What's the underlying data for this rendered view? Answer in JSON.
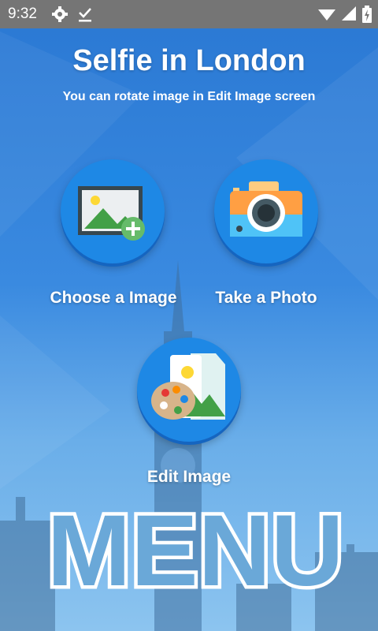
{
  "status_bar": {
    "time": "9:32",
    "icons": [
      "gear-icon",
      "download-done-icon",
      "wifi-icon",
      "signal-icon",
      "battery-charging-icon"
    ]
  },
  "header": {
    "title": "Selfie in London",
    "subtitle": "You can rotate image in Edit Image screen"
  },
  "actions": {
    "choose_image": {
      "label": "Choose a Image",
      "icon": "image-add-icon"
    },
    "take_photo": {
      "label": "Take a Photo",
      "icon": "camera-icon"
    },
    "edit_image": {
      "label": "Edit Image",
      "icon": "palette-image-icon"
    }
  },
  "banner": {
    "text": "MENU"
  },
  "colors": {
    "background": "#2f7fd6",
    "button": "#1e88e5",
    "status_bar": "#757575",
    "banner_fill": "#6aa8d8"
  }
}
